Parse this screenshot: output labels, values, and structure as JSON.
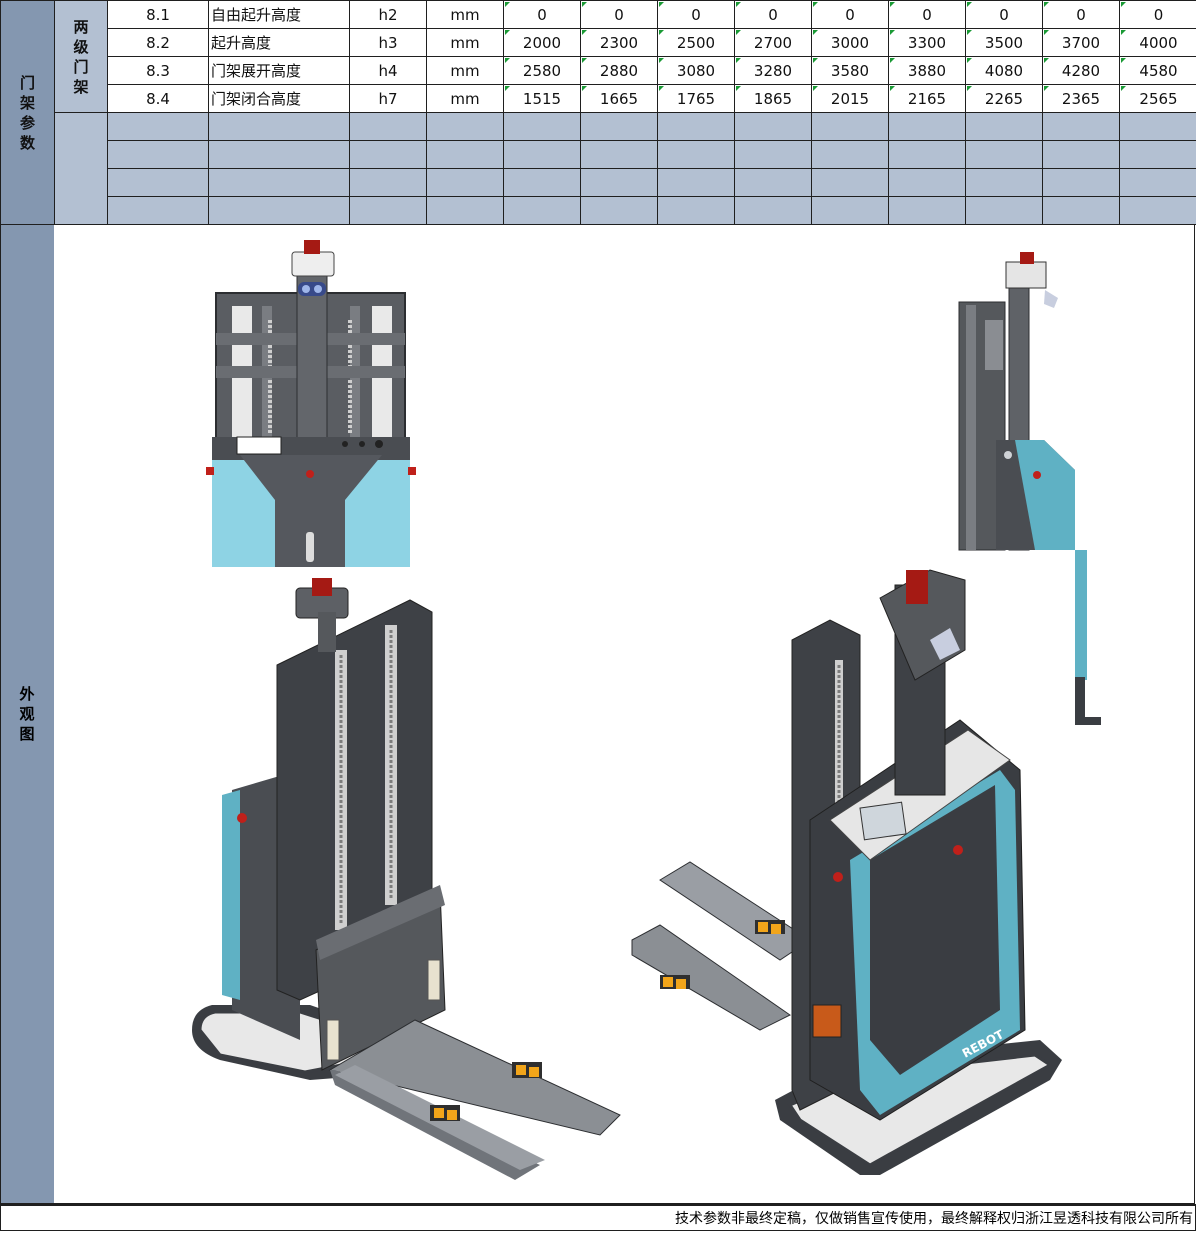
{
  "group_label": "门架参数",
  "subgroup_label": "两级门架",
  "rows": [
    {
      "id": "8.1",
      "name": "自由起升高度",
      "symbol": "h2",
      "unit": "mm",
      "values": [
        "0",
        "0",
        "0",
        "0",
        "0",
        "0",
        "0",
        "0",
        "0"
      ]
    },
    {
      "id": "8.2",
      "name": "起升高度",
      "symbol": "h3",
      "unit": "mm",
      "values": [
        "2000",
        "2300",
        "2500",
        "2700",
        "3000",
        "3300",
        "3500",
        "3700",
        "4000"
      ]
    },
    {
      "id": "8.3",
      "name": "门架展开高度",
      "symbol": "h4",
      "unit": "mm",
      "values": [
        "2580",
        "2880",
        "3080",
        "3280",
        "3580",
        "3880",
        "4080",
        "4280",
        "4580"
      ]
    },
    {
      "id": "8.4",
      "name": "门架闭合高度",
      "symbol": "h7",
      "unit": "mm",
      "values": [
        "1515",
        "1665",
        "1765",
        "1865",
        "2015",
        "2165",
        "2265",
        "2365",
        "2565"
      ]
    }
  ],
  "appearance_label": "外观图",
  "brand_text": "REBOT",
  "footer_note": "技术参数非最终定稿，仅做销售宣传使用，最终解释权归浙江昱透科技有限公司所有",
  "colors": {
    "header_blue": "#8497b0",
    "light_blue": "#b3c0d2",
    "machine_teal": "#5fb1c4",
    "machine_dark": "#3a3d42",
    "warning_red": "#c0201a",
    "pad_orange": "#f2a51a"
  },
  "icons": [
    "forklift-front-view-icon",
    "forklift-side-view-icon",
    "forklift-iso-left-icon",
    "forklift-iso-right-icon"
  ]
}
